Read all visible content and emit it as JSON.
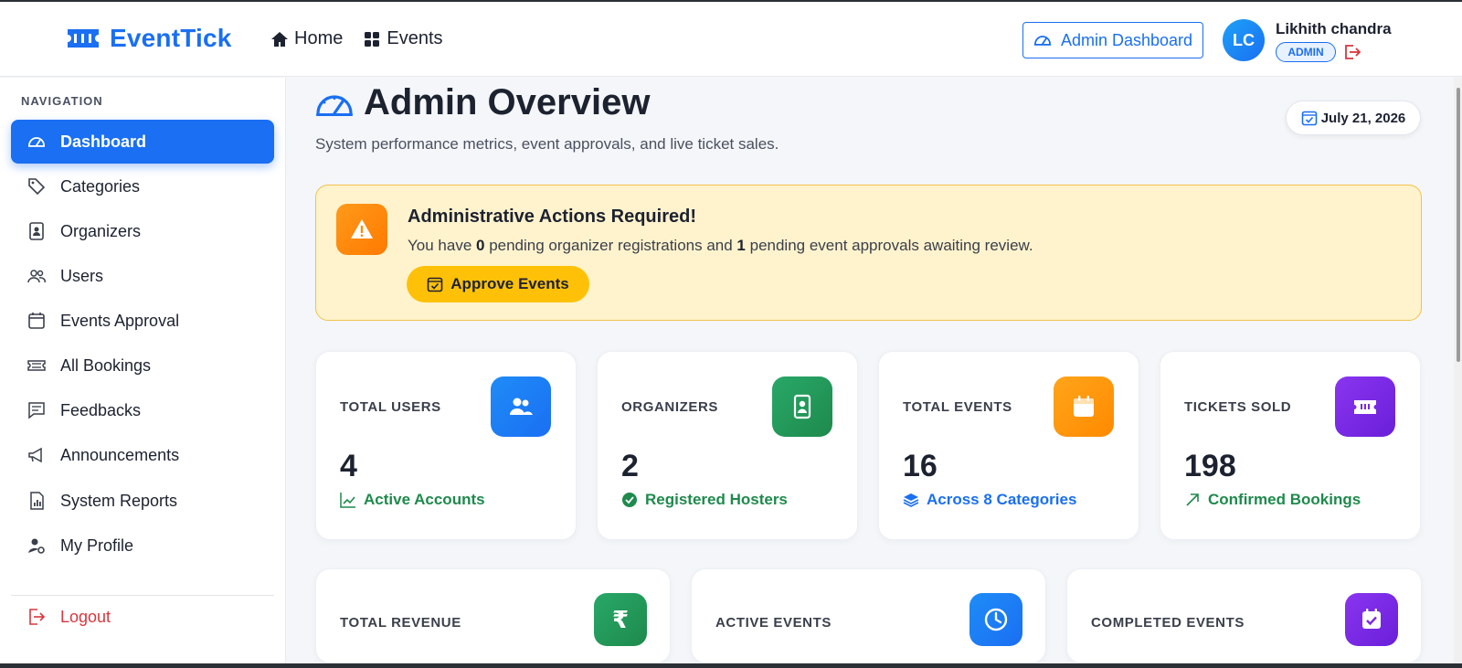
{
  "header": {
    "brand": "EventTick",
    "nav": [
      {
        "label": "Home",
        "icon": "home-icon"
      },
      {
        "label": "Events",
        "icon": "grid-icon"
      }
    ],
    "admin_dashboard_label": "Admin Dashboard",
    "user": {
      "initials": "LC",
      "name": "Likhith chandra",
      "role": "ADMIN"
    }
  },
  "sidebar": {
    "heading": "NAVIGATION",
    "items": [
      {
        "label": "Dashboard",
        "icon": "speedometer-icon",
        "active": true
      },
      {
        "label": "Categories",
        "icon": "tag-icon"
      },
      {
        "label": "Organizers",
        "icon": "badge-icon"
      },
      {
        "label": "Users",
        "icon": "users-icon"
      },
      {
        "label": "Events Approval",
        "icon": "calendar-icon"
      },
      {
        "label": "All Bookings",
        "icon": "ticket-icon"
      },
      {
        "label": "Feedbacks",
        "icon": "chat-icon"
      },
      {
        "label": "Announcements",
        "icon": "megaphone-icon"
      },
      {
        "label": "System Reports",
        "icon": "report-icon"
      },
      {
        "label": "My Profile",
        "icon": "user-gear-icon"
      }
    ],
    "logout_label": "Logout"
  },
  "main": {
    "title": "Admin Overview",
    "subtitle": "System performance metrics, event approvals, and live ticket sales.",
    "date": "July 21, 2026",
    "alert": {
      "title": "Administrative Actions Required!",
      "text_prefix": "You have ",
      "pending_organizers": "0",
      "text_middle": " pending organizer registrations and ",
      "pending_events": "1",
      "text_suffix": " pending event approvals awaiting review.",
      "button_label": "Approve Events"
    },
    "stats": [
      {
        "label": "TOTAL USERS",
        "value": "4",
        "sub": "Active Accounts",
        "icon": "users-icon",
        "color": "#1a6ff2"
      },
      {
        "label": "ORGANIZERS",
        "value": "2",
        "sub": "Registered Hosters",
        "icon": "badge-icon",
        "color": "#1e8a4c"
      },
      {
        "label": "TOTAL EVENTS",
        "value": "16",
        "sub": "Across 8 Categories",
        "icon": "calendar-icon",
        "color": "#ff8a00"
      },
      {
        "label": "TICKETS SOLD",
        "value": "198",
        "sub": "Confirmed Bookings",
        "icon": "ticket-icon",
        "color": "#6a1fd8"
      }
    ],
    "stats2": [
      {
        "label": "TOTAL REVENUE",
        "icon": "rupee-icon",
        "color": "#1e8a4c"
      },
      {
        "label": "ACTIVE EVENTS",
        "icon": "clock-icon",
        "color": "#1a6ff2"
      },
      {
        "label": "COMPLETED EVENTS",
        "icon": "calendar-check-icon",
        "color": "#6a1fd8"
      }
    ]
  }
}
